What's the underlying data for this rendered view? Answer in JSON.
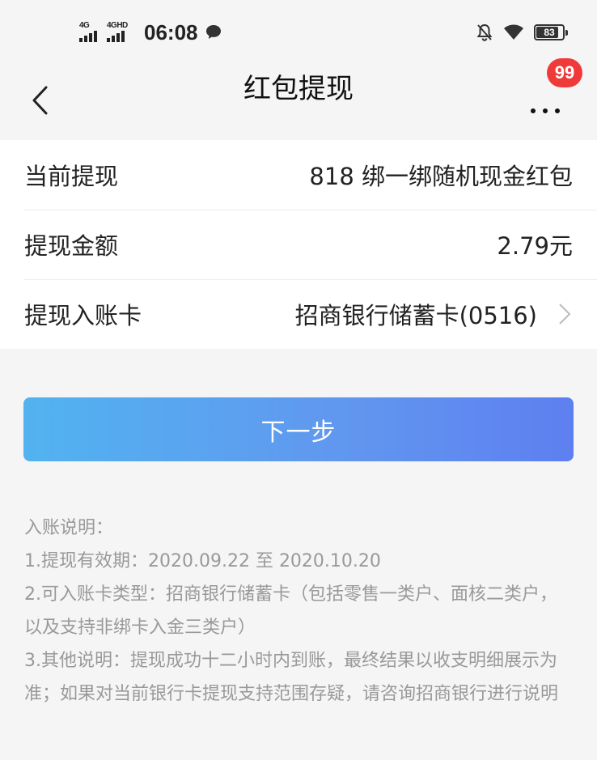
{
  "status_bar": {
    "signal_1_label": "4G",
    "signal_2_label": "4GHD",
    "time": "06:08",
    "battery": "83",
    "icons": [
      "chat-bubble-icon",
      "mute-bell-icon",
      "wifi-icon",
      "battery-icon"
    ]
  },
  "nav": {
    "title": "红包提现",
    "badge": "99",
    "icons": [
      "back-arrow-icon",
      "more-dots-icon"
    ]
  },
  "rows": [
    {
      "label": "当前提现",
      "value": "818 绑一绑随机现金红包"
    },
    {
      "label": "提现金额",
      "value": "2.79元"
    },
    {
      "label": "提现入账卡",
      "value": "招商银行储蓄卡(0516)"
    }
  ],
  "button": {
    "label": "下一步"
  },
  "notes": {
    "title": "入账说明：",
    "lines": [
      "1.提现有效期：2020.09.22 至 2020.10.20",
      "2.可入账卡类型：招商银行储蓄卡（包括零售一类户、面核二类户，以及支持非绑卡入金三类户）",
      "3.其他说明：提现成功十二小时内到账，最终结果以收支明细展示为准；如果对当前银行卡提现支持范围存疑，请咨询招商银行进行说明"
    ]
  },
  "colors": {
    "badge": "#f03a3a",
    "button_start": "#52b3f0",
    "button_end": "#5e7ff0",
    "note_text": "#999999"
  }
}
